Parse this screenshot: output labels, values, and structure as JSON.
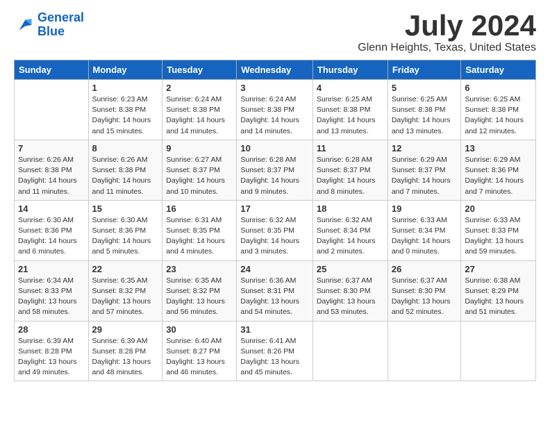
{
  "logo": {
    "line1": "General",
    "line2": "Blue"
  },
  "title": "July 2024",
  "location": "Glenn Heights, Texas, United States",
  "weekdays": [
    "Sunday",
    "Monday",
    "Tuesday",
    "Wednesday",
    "Thursday",
    "Friday",
    "Saturday"
  ],
  "weeks": [
    [
      {
        "day": "",
        "detail": ""
      },
      {
        "day": "1",
        "detail": "Sunrise: 6:23 AM\nSunset: 8:38 PM\nDaylight: 14 hours\nand 15 minutes."
      },
      {
        "day": "2",
        "detail": "Sunrise: 6:24 AM\nSunset: 8:38 PM\nDaylight: 14 hours\nand 14 minutes."
      },
      {
        "day": "3",
        "detail": "Sunrise: 6:24 AM\nSunset: 8:38 PM\nDaylight: 14 hours\nand 14 minutes."
      },
      {
        "day": "4",
        "detail": "Sunrise: 6:25 AM\nSunset: 8:38 PM\nDaylight: 14 hours\nand 13 minutes."
      },
      {
        "day": "5",
        "detail": "Sunrise: 6:25 AM\nSunset: 8:38 PM\nDaylight: 14 hours\nand 13 minutes."
      },
      {
        "day": "6",
        "detail": "Sunrise: 6:25 AM\nSunset: 8:38 PM\nDaylight: 14 hours\nand 12 minutes."
      }
    ],
    [
      {
        "day": "7",
        "detail": "Sunrise: 6:26 AM\nSunset: 8:38 PM\nDaylight: 14 hours\nand 11 minutes."
      },
      {
        "day": "8",
        "detail": "Sunrise: 6:26 AM\nSunset: 8:38 PM\nDaylight: 14 hours\nand 11 minutes."
      },
      {
        "day": "9",
        "detail": "Sunrise: 6:27 AM\nSunset: 8:37 PM\nDaylight: 14 hours\nand 10 minutes."
      },
      {
        "day": "10",
        "detail": "Sunrise: 6:28 AM\nSunset: 8:37 PM\nDaylight: 14 hours\nand 9 minutes."
      },
      {
        "day": "11",
        "detail": "Sunrise: 6:28 AM\nSunset: 8:37 PM\nDaylight: 14 hours\nand 8 minutes."
      },
      {
        "day": "12",
        "detail": "Sunrise: 6:29 AM\nSunset: 8:37 PM\nDaylight: 14 hours\nand 7 minutes."
      },
      {
        "day": "13",
        "detail": "Sunrise: 6:29 AM\nSunset: 8:36 PM\nDaylight: 14 hours\nand 7 minutes."
      }
    ],
    [
      {
        "day": "14",
        "detail": "Sunrise: 6:30 AM\nSunset: 8:36 PM\nDaylight: 14 hours\nand 6 minutes."
      },
      {
        "day": "15",
        "detail": "Sunrise: 6:30 AM\nSunset: 8:36 PM\nDaylight: 14 hours\nand 5 minutes."
      },
      {
        "day": "16",
        "detail": "Sunrise: 6:31 AM\nSunset: 8:35 PM\nDaylight: 14 hours\nand 4 minutes."
      },
      {
        "day": "17",
        "detail": "Sunrise: 6:32 AM\nSunset: 8:35 PM\nDaylight: 14 hours\nand 3 minutes."
      },
      {
        "day": "18",
        "detail": "Sunrise: 6:32 AM\nSunset: 8:34 PM\nDaylight: 14 hours\nand 2 minutes."
      },
      {
        "day": "19",
        "detail": "Sunrise: 6:33 AM\nSunset: 8:34 PM\nDaylight: 14 hours\nand 0 minutes."
      },
      {
        "day": "20",
        "detail": "Sunrise: 6:33 AM\nSunset: 8:33 PM\nDaylight: 13 hours\nand 59 minutes."
      }
    ],
    [
      {
        "day": "21",
        "detail": "Sunrise: 6:34 AM\nSunset: 8:33 PM\nDaylight: 13 hours\nand 58 minutes."
      },
      {
        "day": "22",
        "detail": "Sunrise: 6:35 AM\nSunset: 8:32 PM\nDaylight: 13 hours\nand 57 minutes."
      },
      {
        "day": "23",
        "detail": "Sunrise: 6:35 AM\nSunset: 8:32 PM\nDaylight: 13 hours\nand 56 minutes."
      },
      {
        "day": "24",
        "detail": "Sunrise: 6:36 AM\nSunset: 8:31 PM\nDaylight: 13 hours\nand 54 minutes."
      },
      {
        "day": "25",
        "detail": "Sunrise: 6:37 AM\nSunset: 8:30 PM\nDaylight: 13 hours\nand 53 minutes."
      },
      {
        "day": "26",
        "detail": "Sunrise: 6:37 AM\nSunset: 8:30 PM\nDaylight: 13 hours\nand 52 minutes."
      },
      {
        "day": "27",
        "detail": "Sunrise: 6:38 AM\nSunset: 8:29 PM\nDaylight: 13 hours\nand 51 minutes."
      }
    ],
    [
      {
        "day": "28",
        "detail": "Sunrise: 6:39 AM\nSunset: 8:28 PM\nDaylight: 13 hours\nand 49 minutes."
      },
      {
        "day": "29",
        "detail": "Sunrise: 6:39 AM\nSunset: 8:28 PM\nDaylight: 13 hours\nand 48 minutes."
      },
      {
        "day": "30",
        "detail": "Sunrise: 6:40 AM\nSunset: 8:27 PM\nDaylight: 13 hours\nand 46 minutes."
      },
      {
        "day": "31",
        "detail": "Sunrise: 6:41 AM\nSunset: 8:26 PM\nDaylight: 13 hours\nand 45 minutes."
      },
      {
        "day": "",
        "detail": ""
      },
      {
        "day": "",
        "detail": ""
      },
      {
        "day": "",
        "detail": ""
      }
    ]
  ]
}
